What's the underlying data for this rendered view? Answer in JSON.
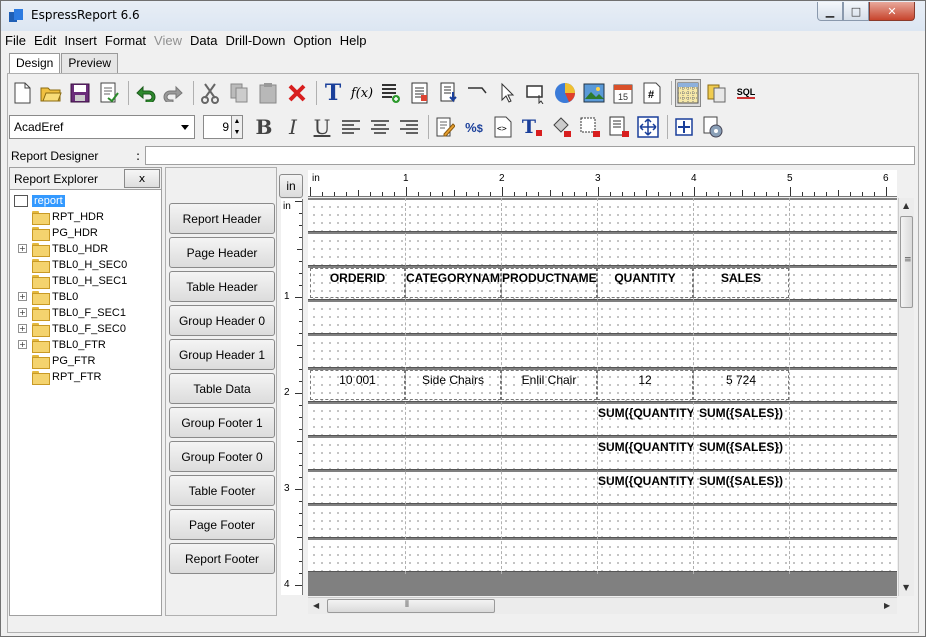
{
  "window": {
    "title": "EspressReport 6.6"
  },
  "menu": [
    "File",
    "Edit",
    "Insert",
    "Format",
    "View",
    "Data",
    "Drill-Down",
    "Option",
    "Help"
  ],
  "menu_disabled": [
    "View"
  ],
  "tabs": [
    {
      "label": "Design",
      "active": true
    },
    {
      "label": "Preview",
      "active": false
    }
  ],
  "toolbar1": [
    "new-file",
    "open-folder",
    "save",
    "page-setup",
    "undo",
    "redo",
    "cut",
    "copy",
    "paste",
    "delete",
    "text-label",
    "formula",
    "insert-column",
    "insert-subreport",
    "import",
    "line",
    "pointer",
    "rectangle",
    "chart",
    "image",
    "date",
    "page-number",
    "grid-toggle",
    "database",
    "sql"
  ],
  "font": {
    "name": "AcadEref",
    "size": "9"
  },
  "toolbar2": [
    "bold",
    "italic",
    "underline",
    "align-left",
    "align-center",
    "align-right",
    "edit",
    "percent-dollar",
    "html-tag",
    "text-color",
    "fill-color",
    "border",
    "format-painter",
    "resize",
    "move",
    "settings"
  ],
  "report_designer": {
    "label": "Report Designer",
    "colon": ":",
    "value": ""
  },
  "explorer": {
    "title": "Report Explorer",
    "close_label": "x",
    "root": "report",
    "items": [
      {
        "label": "RPT_HDR",
        "expandable": false
      },
      {
        "label": "PG_HDR",
        "expandable": false
      },
      {
        "label": "TBL0_HDR",
        "expandable": true
      },
      {
        "label": "TBL0_H_SEC0",
        "expandable": false
      },
      {
        "label": "TBL0_H_SEC1",
        "expandable": false
      },
      {
        "label": "TBL0",
        "expandable": true
      },
      {
        "label": "TBL0_F_SEC1",
        "expandable": true
      },
      {
        "label": "TBL0_F_SEC0",
        "expandable": true
      },
      {
        "label": "TBL0_FTR",
        "expandable": true
      },
      {
        "label": "PG_FTR",
        "expandable": false
      },
      {
        "label": "RPT_FTR",
        "expandable": false
      }
    ]
  },
  "sections": [
    "Report Header",
    "Page Header",
    "Table Header",
    "Group Header 0",
    "Group Header 1",
    "Table Data",
    "Group Footer 1",
    "Group Footer 0",
    "Table Footer",
    "Page Footer",
    "Report Footer"
  ],
  "unit_label": "in",
  "hruler": {
    "unit": "in",
    "labels": [
      "1",
      "2",
      "3",
      "4",
      "5",
      "6"
    ]
  },
  "vruler": {
    "unit": "in",
    "labels": [
      "1",
      "2",
      "3",
      "4"
    ]
  },
  "table_header": [
    "ORDERID",
    "CATEGORYNAME",
    "PRODUCTNAME",
    "QUANTITY",
    "SALES"
  ],
  "table_data": [
    "10 001",
    "Side Chairs",
    "Enlil Chair",
    "12",
    "5 724"
  ],
  "group_footer_1": [
    "SUM({QUANTITY",
    "SUM({SALES})"
  ],
  "group_footer_0": [
    "SUM({QUANTITY",
    "SUM({SALES})"
  ],
  "table_footer": [
    "SUM({QUANTITY",
    "SUM({SALES})"
  ]
}
